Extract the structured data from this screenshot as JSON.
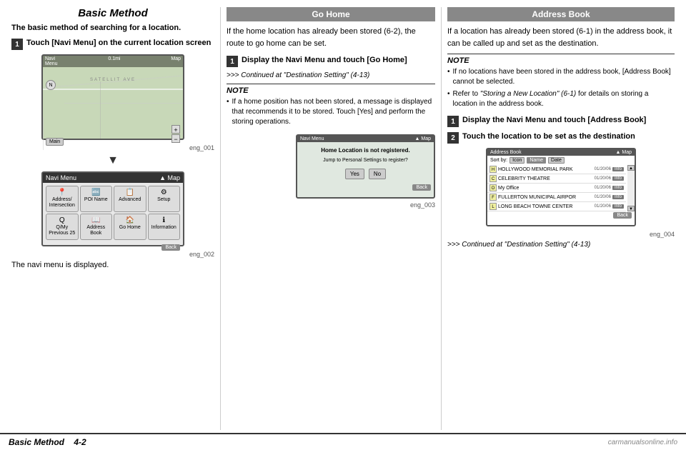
{
  "page": {
    "title": "Basic Method",
    "footer_left": "Basic Method",
    "footer_page": "4-2"
  },
  "left_col": {
    "title": "Basic Method",
    "intro": "The basic method of searching for a location.",
    "step1_label": "1",
    "step1_text": "Touch [Navi Menu] on the current location screen",
    "screen1_label": "eng_001",
    "screen2_label": "eng_002",
    "caption": "The navi menu is displayed.",
    "map_label": "Map",
    "navi_menu_label": "Navi Menu",
    "navi_btns": [
      {
        "icon": "📍",
        "label": "Address/\nIntersection"
      },
      {
        "icon": "🔤",
        "label": "POI Name"
      },
      {
        "icon": "📋",
        "label": "Advanced"
      },
      {
        "icon": "⚙",
        "label": "Setup"
      },
      {
        "icon": "Q",
        "label": "Q/My\nPrevious 25"
      },
      {
        "icon": "📖",
        "label": "Address\nBook"
      },
      {
        "icon": "🏠",
        "label": "Go Home"
      },
      {
        "icon": "ℹ",
        "label": "Information"
      }
    ],
    "back_btn": "Back"
  },
  "mid_col": {
    "title": "Go Home",
    "intro": "If the home location has already been stored (6-2), the route to go home can be set.",
    "step1_label": "1",
    "step1_text": "Display the Navi Menu and touch [Go Home]",
    "continued": ">>> Continued at \"Destination Setting\" (4-13)",
    "note_title": "NOTE",
    "note_bullet": "If a home position has not been stored, a message is displayed that recommends it to be stored. Touch [Yes] and perform the storing operations.",
    "screen_label": "eng_003",
    "home_screen_title": "Navi Menu",
    "home_screen_map": "Map",
    "home_msg": "Home Location is not registered.",
    "home_msg2": "Jump to Personal Settings to register?",
    "yes_btn": "Yes",
    "no_btn": "No",
    "back_btn": "Back"
  },
  "right_col": {
    "title": "Address Book",
    "intro": "If a location has already been stored (6-1) in the address book, it can be called up and set as the destination.",
    "note_title": "NOTE",
    "note_bullets": [
      "If no locations have been stored in the address book, [Address Book] cannot be selected.",
      "Refer to \"Storing a New Location\" (6-1) for details on storing a location in the address book."
    ],
    "step1_label": "1",
    "step1_text": "Display the Navi Menu and touch [Address Book]",
    "step2_label": "2",
    "step2_text": "Touch the location to be set as the destination",
    "screen_label": "eng_004",
    "addr_title": "Address Book",
    "addr_map": "Map",
    "sort_label": "Sort by:",
    "sort_btns": [
      "Icon",
      "Name",
      "Date"
    ],
    "addr_rows": [
      {
        "icon": "H",
        "name": "HOLLYWOOD MEMORIAL PARK",
        "date": "01/20/06"
      },
      {
        "icon": "C",
        "name": "CELEBRITY THEATRE",
        "date": "01/20/06"
      },
      {
        "icon": "O",
        "name": "My Office",
        "date": "01/20/06"
      },
      {
        "icon": "F",
        "name": "FULLERTON MUNICIPAL AIRPOR",
        "date": "01/20/06"
      },
      {
        "icon": "L",
        "name": "LONG BEACH TOWNE CENTER",
        "date": "01/20/06"
      }
    ],
    "back_btn": "Back",
    "continued": ">>> Continued at \"Destination Setting\" (4-13)"
  },
  "watermark": "carmanualsonline.info"
}
